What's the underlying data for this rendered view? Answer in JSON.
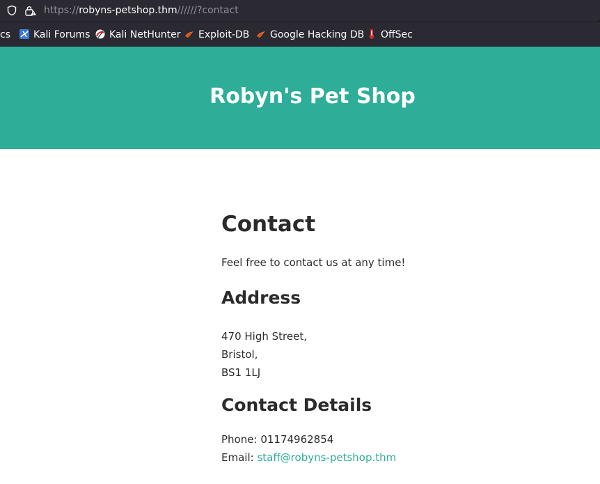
{
  "browser": {
    "url_scheme": "https://",
    "url_host": "robyns-petshop.thm",
    "url_rest": "//////?contact"
  },
  "bookmarks": [
    {
      "label": "cs",
      "icon": "none"
    },
    {
      "label": "Kali Forums",
      "icon": "kali-dragon-icon"
    },
    {
      "label": "Kali NetHunter",
      "icon": "nethunter-icon"
    },
    {
      "label": "Exploit-DB",
      "icon": "exploit-db-icon"
    },
    {
      "label": "Google Hacking DB",
      "icon": "ghdb-icon"
    },
    {
      "label": "OffSec",
      "icon": "offsec-icon"
    }
  ],
  "site": {
    "title": "Robyn's Pet Shop",
    "accent": "#2eae98"
  },
  "contact": {
    "heading": "Contact",
    "intro": "Feel free to contact us at any time!",
    "address_heading": "Address",
    "address_lines": [
      "470 High Street,",
      "Bristol,",
      "BS1 1LJ"
    ],
    "details_heading": "Contact Details",
    "phone_label": "Phone:",
    "phone_value": "01174962854",
    "email_label": "Email:",
    "email_value": "staff@robyns-petshop.thm"
  }
}
